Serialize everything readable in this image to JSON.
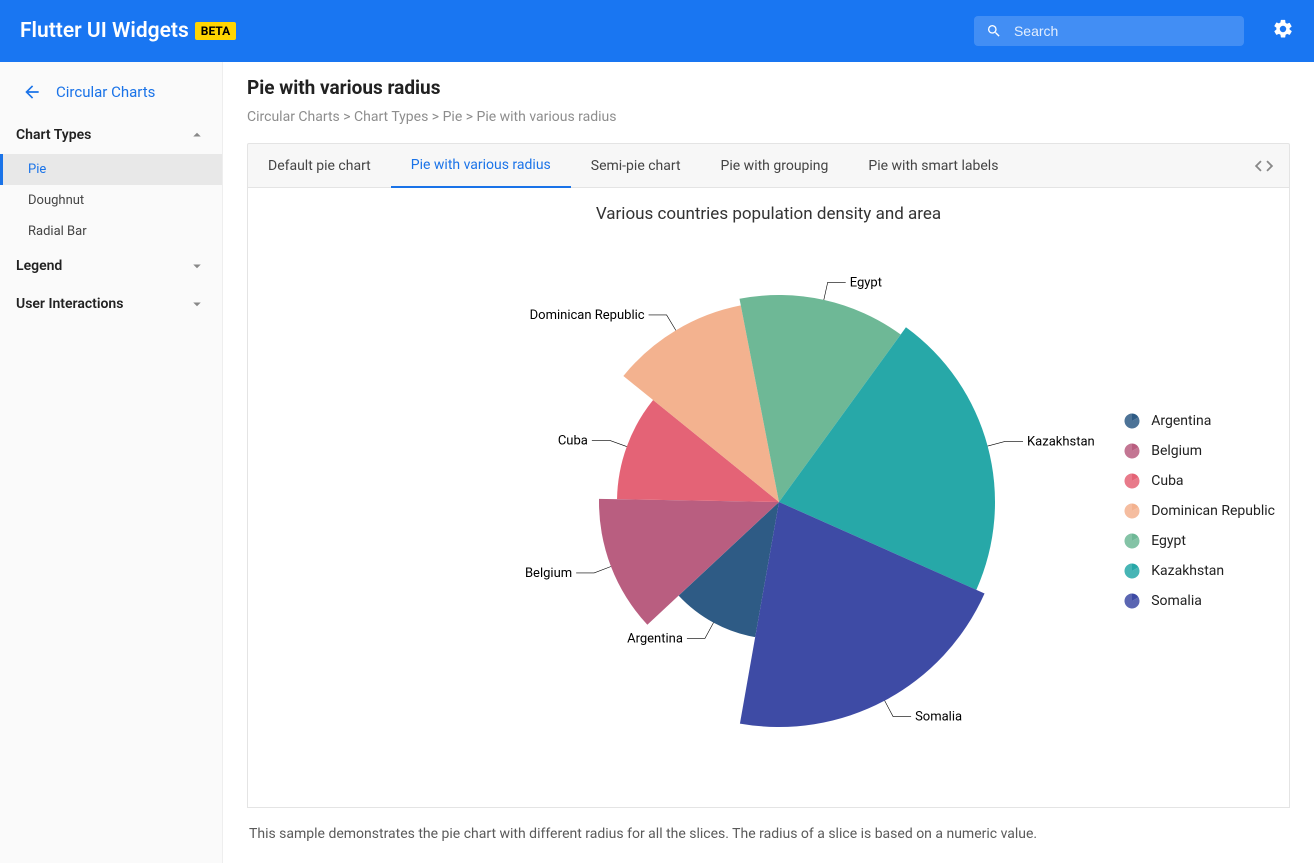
{
  "header": {
    "title": "Flutter UI Widgets",
    "badge": "BETA",
    "search_placeholder": "Search"
  },
  "sidebar": {
    "title": "Circular Charts",
    "sections": [
      {
        "label": "Chart Types",
        "expanded": true,
        "items": [
          "Pie",
          "Doughnut",
          "Radial Bar"
        ],
        "active_index": 0
      },
      {
        "label": "Legend",
        "expanded": false
      },
      {
        "label": "User Interactions",
        "expanded": false
      }
    ]
  },
  "page": {
    "title": "Pie with various radius",
    "breadcrumb": "Circular Charts > Chart Types > Pie > Pie with various radius",
    "tabs": [
      "Default pie chart",
      "Pie with various radius",
      "Semi-pie chart",
      "Pie with grouping",
      "Pie with smart labels"
    ],
    "active_tab_index": 1,
    "description": "This sample demonstrates the pie chart with different radius for all the slices. The radius of a slice is based on a numeric value."
  },
  "chart_data": {
    "type": "pie",
    "title": "Various countries population density and area",
    "series": [
      {
        "name": "Argentina",
        "angle": 37,
        "radius": 0.61,
        "color": "#2e5b85"
      },
      {
        "name": "Belgium",
        "angle": 44,
        "radius": 0.8,
        "color": "#b95e80"
      },
      {
        "name": "Cuba",
        "angle": 38,
        "radius": 0.72,
        "color": "#e46376"
      },
      {
        "name": "Dominican Republic",
        "angle": 40,
        "radius": 0.89,
        "color": "#f3b28f"
      },
      {
        "name": "Egypt",
        "angle": 47,
        "radius": 0.92,
        "color": "#6eb896"
      },
      {
        "name": "Kazakhstan",
        "angle": 78,
        "radius": 0.96,
        "color": "#27a8a8"
      },
      {
        "name": "Somalia",
        "angle": 76,
        "radius": 1.0,
        "color": "#3e4ba5"
      }
    ],
    "legend": [
      "Argentina",
      "Belgium",
      "Cuba",
      "Dominican Republic",
      "Egypt",
      "Kazakhstan",
      "Somalia"
    ],
    "legend_colors": [
      "#2e5b85",
      "#b95e80",
      "#e46376",
      "#f3b28f",
      "#6eb896",
      "#27a8a8",
      "#3e4ba5"
    ]
  }
}
